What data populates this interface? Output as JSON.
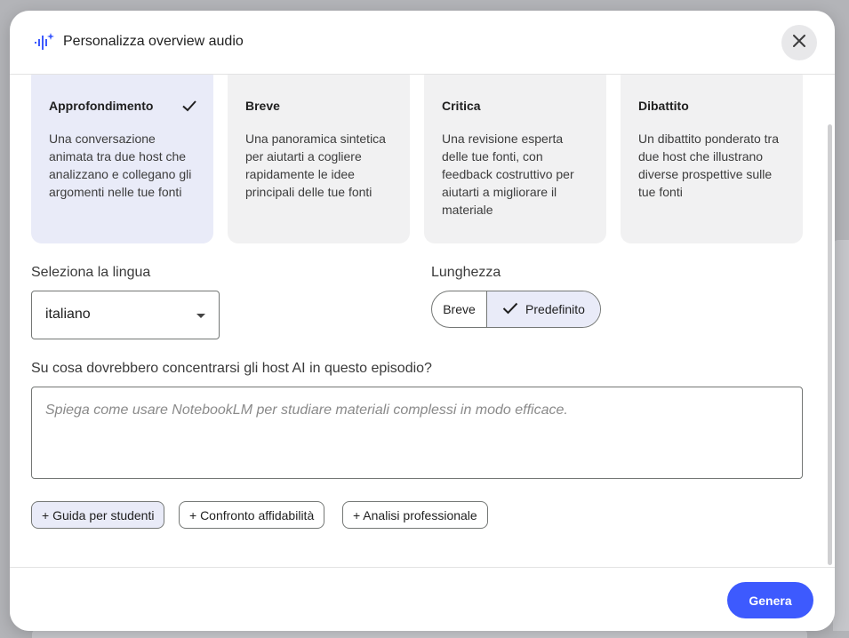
{
  "dialog": {
    "title": "Personalizza overview audio",
    "icon": "audio-sparkle-icon",
    "close_icon": "close-icon"
  },
  "formats": [
    {
      "title": "Approfondimento",
      "description": "Una conversazione animata tra due host che analizzano e collegano gli argomenti nelle tue fonti",
      "selected": true
    },
    {
      "title": "Breve",
      "description": "Una panoramica sintetica per aiutarti a cogliere rapidamente le idee principali delle tue fonti",
      "selected": false
    },
    {
      "title": "Critica",
      "description": "Una revisione esperta delle tue fonti, con feedback costruttivo per aiutarti a migliorare il materiale",
      "selected": false
    },
    {
      "title": "Dibattito",
      "description": "Un dibattito ponderato tra due host che illustrano diverse prospettive sulle tue fonti",
      "selected": false
    }
  ],
  "language": {
    "label": "Seleziona la lingua",
    "value": "italiano"
  },
  "length": {
    "label": "Lunghezza",
    "options": [
      "Breve",
      "Predefinito"
    ],
    "selected": "Predefinito"
  },
  "focus": {
    "label": "Su cosa dovrebbero concentrarsi gli host AI in questo episodio?",
    "placeholder": "Spiega come usare NotebookLM per studiare materiali complessi in modo efficace.",
    "value": ""
  },
  "suggestions": [
    "+ Guida per studenti",
    "+ Confronto affidabilità",
    "+ Analisi professionale"
  ],
  "footer": {
    "generate_label": "Genera"
  },
  "colors": {
    "accent": "#3d5afe",
    "selected_bg": "#e9ebf8",
    "card_bg": "#f1f1f2"
  }
}
